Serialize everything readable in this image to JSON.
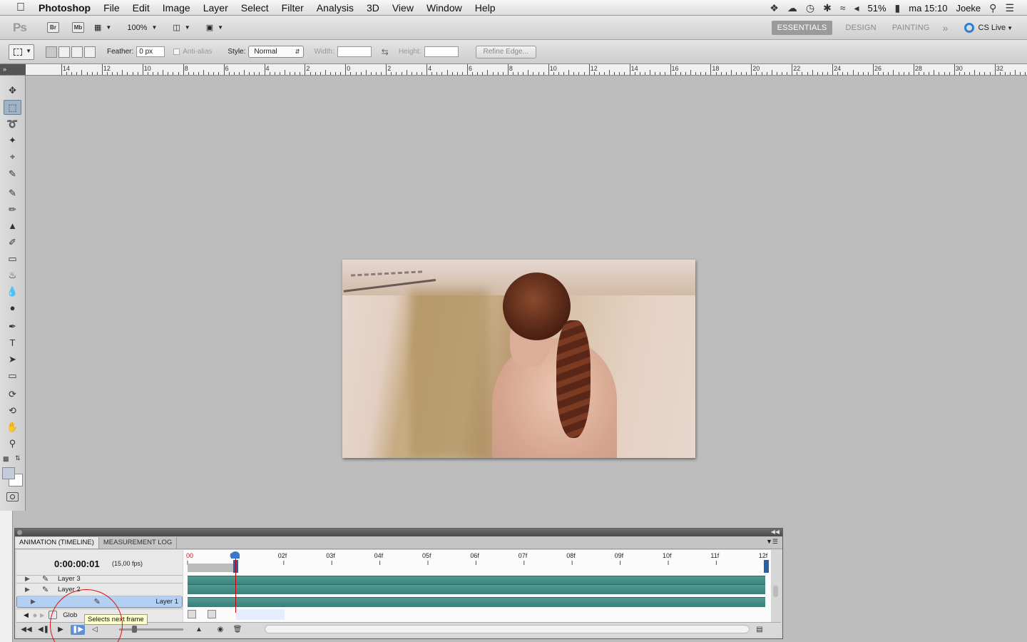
{
  "menubar": {
    "app": "Photoshop",
    "items": [
      "File",
      "Edit",
      "Image",
      "Layer",
      "Select",
      "Filter",
      "Analysis",
      "3D",
      "View",
      "Window",
      "Help"
    ],
    "battery": "51%",
    "clock": "ma 15:10",
    "user": "Joeke"
  },
  "appbar": {
    "logo": "Ps",
    "bridge": "Br",
    "minibridge": "Mb",
    "zoom": "100%",
    "workspaces": [
      "ESSENTIALS",
      "DESIGN",
      "PAINTING"
    ],
    "active_workspace": "ESSENTIALS",
    "cslive": "CS Live"
  },
  "options": {
    "feather_label": "Feather:",
    "feather_value": "0 px",
    "antialias_label": "Anti-alias",
    "style_label": "Style:",
    "style_value": "Normal",
    "width_label": "Width:",
    "height_label": "Height:",
    "refine_label": "Refine Edge..."
  },
  "ruler": {
    "labels": [
      "14",
      "12",
      "10",
      "8",
      "6",
      "4",
      "2",
      "0",
      "2",
      "4",
      "6",
      "8",
      "10",
      "12",
      "14",
      "16",
      "18",
      "20",
      "22",
      "24",
      "26",
      "28",
      "30",
      "32"
    ]
  },
  "timeline": {
    "tabs": [
      "ANIMATION (TIMELINE)",
      "MEASUREMENT LOG"
    ],
    "active_tab": "ANIMATION (TIMELINE)",
    "timecode": "0:00:00:01",
    "fps": "(15,00 fps)",
    "frames": [
      "00",
      "01f",
      "02f",
      "03f",
      "04f",
      "05f",
      "06f",
      "07f",
      "08f",
      "09f",
      "10f",
      "11f",
      "12f"
    ],
    "layers": [
      {
        "name": "Layer 3",
        "selected": false
      },
      {
        "name": "Layer 2",
        "selected": false
      },
      {
        "name": "Layer 1",
        "selected": true
      }
    ],
    "global_label": "Glob",
    "tooltip": "Selects next frame",
    "current_frame": 1
  }
}
